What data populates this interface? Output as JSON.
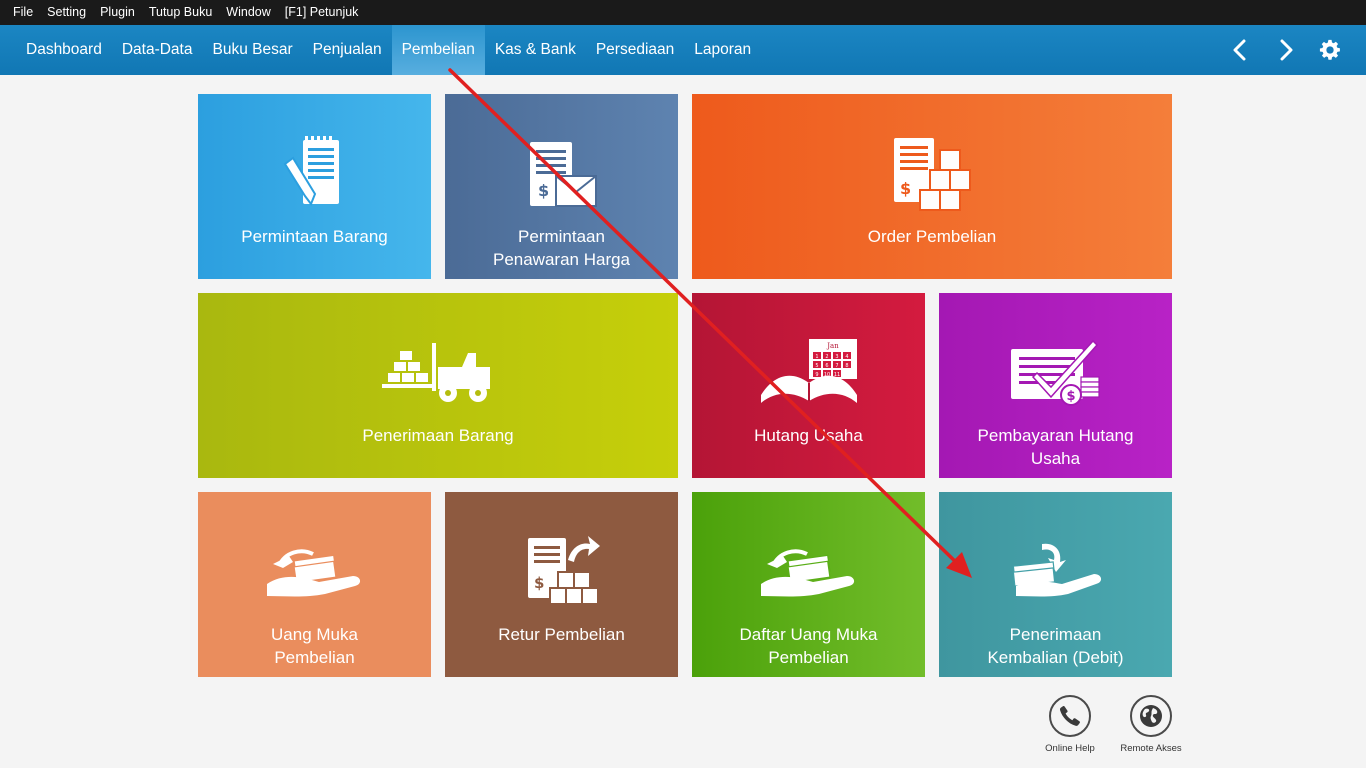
{
  "menubar": {
    "items": [
      "File",
      "Setting",
      "Plugin",
      "Tutup Buku",
      "Window",
      "[F1] Petunjuk"
    ]
  },
  "navbar": {
    "tabs": [
      "Dashboard",
      "Data-Data",
      "Buku Besar",
      "Penjualan",
      "Pembelian",
      "Kas & Bank",
      "Persediaan",
      "Laporan"
    ],
    "active_tab": "Pembelian",
    "controls": [
      "back-icon",
      "forward-icon",
      "gear-icon"
    ]
  },
  "tiles": {
    "permintaan_barang": {
      "line1": "Permintaan Barang",
      "line2": "",
      "icon": "notepad-pencil-icon"
    },
    "permintaan_penawaran": {
      "line1": "Permintaan",
      "line2": "Penawaran Harga",
      "icon": "invoice-envelope-icon"
    },
    "order_pembelian": {
      "line1": "Order Pembelian",
      "line2": "",
      "icon": "invoice-boxes-icon"
    },
    "penerimaan_barang": {
      "line1": "Penerimaan Barang",
      "line2": "",
      "icon": "forklift-icon"
    },
    "hutang_usaha": {
      "line1": "Hutang Usaha",
      "line2": "",
      "icon": "calendar-book-icon",
      "calendar_month": "Jan",
      "calendar_days": [
        "1",
        "2",
        "3",
        "4",
        "5",
        "6",
        "7",
        "8",
        "9",
        "10",
        "11"
      ]
    },
    "pembayaran_hutang": {
      "line1": "Pembayaran Hutang",
      "line2": "Usaha",
      "icon": "checked-invoice-coins-icon"
    },
    "uang_muka": {
      "line1": "Uang Muka",
      "line2": "Pembelian",
      "icon": "hand-cash-icon"
    },
    "retur_pembelian": {
      "line1": "Retur Pembelian",
      "line2": "",
      "icon": "return-invoice-icon"
    },
    "daftar_uang_muka": {
      "line1": "Daftar Uang Muka",
      "line2": "Pembelian",
      "icon": "hand-cash-icon"
    },
    "penerimaan_kembalian": {
      "line1": "Penerimaan",
      "line2": "Kembalian (Debit)",
      "icon": "hand-receive-cash-icon"
    }
  },
  "helpers": {
    "online_help": "Online Help",
    "remote_akses": "Remote Akses"
  },
  "colors": {
    "menubar_bg": "#1a1a1a",
    "navbar_bg": "#1479b8",
    "annotation_arrow": "#e02020"
  }
}
